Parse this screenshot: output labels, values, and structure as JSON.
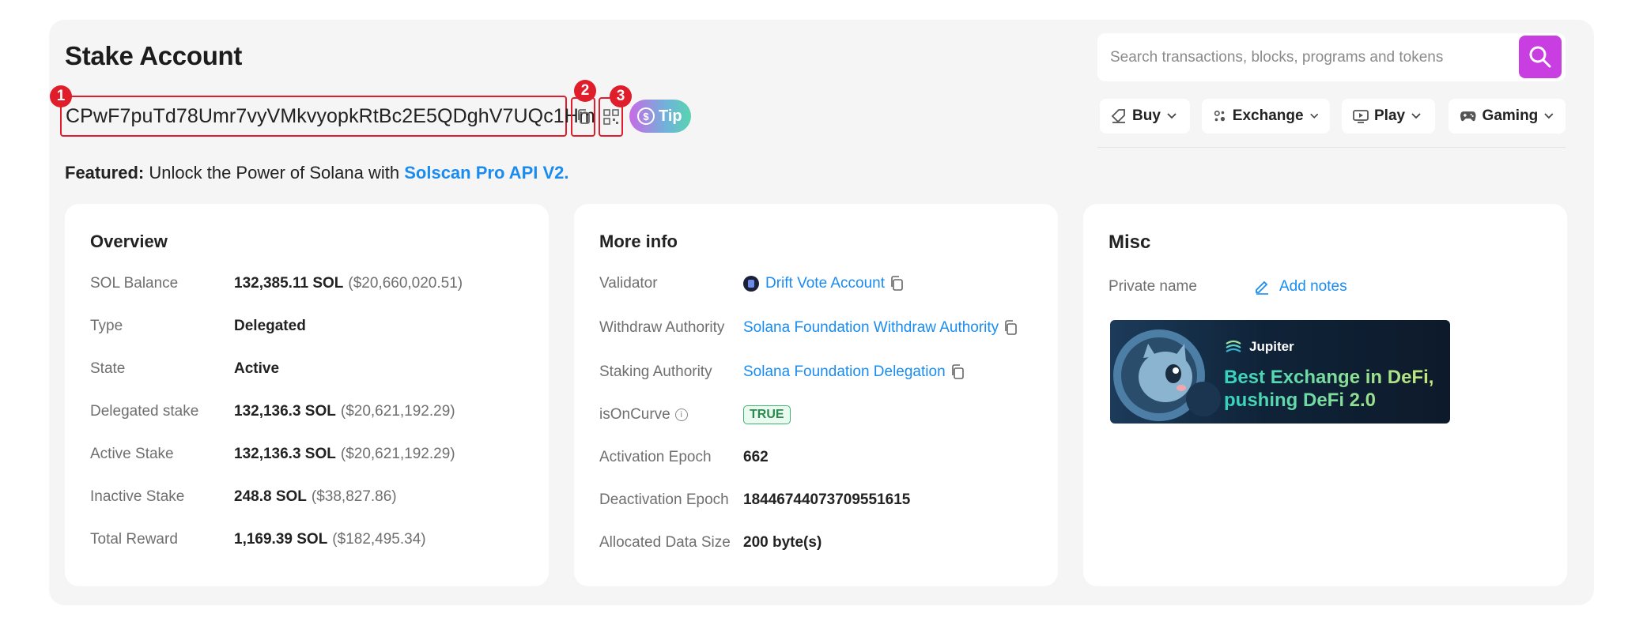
{
  "page": {
    "title": "Stake Account"
  },
  "search": {
    "placeholder": "Search transactions, blocks, programs and tokens"
  },
  "address": {
    "value": "CPwF7puTd78Umr7vyVMkvyopkRtBc2E5QDghV7UQc1Hm",
    "markers": [
      "1",
      "2",
      "3"
    ],
    "tip_label": "Tip"
  },
  "nav": {
    "buy": "Buy",
    "exchange": "Exchange",
    "play": "Play",
    "gaming": "Gaming"
  },
  "featured": {
    "prefix": "Featured:",
    "text": "Unlock the Power of Solana with",
    "link": "Solscan Pro API V2."
  },
  "overview": {
    "title": "Overview",
    "rows": [
      {
        "label": "SOL Balance",
        "value": "132,385.11 SOL",
        "usd": "($20,660,020.51)"
      },
      {
        "label": "Type",
        "value": "Delegated",
        "usd": ""
      },
      {
        "label": "State",
        "value": "Active",
        "usd": ""
      },
      {
        "label": "Delegated stake",
        "value": "132,136.3 SOL",
        "usd": "($20,621,192.29)"
      },
      {
        "label": "Active Stake",
        "value": "132,136.3 SOL",
        "usd": "($20,621,192.29)"
      },
      {
        "label": "Inactive Stake",
        "value": "248.8 SOL",
        "usd": "($38,827.86)"
      },
      {
        "label": "Total Reward",
        "value": "1,169.39 SOL",
        "usd": "($182,495.34)"
      }
    ]
  },
  "more_info": {
    "title": "More info",
    "validator_label": "Validator",
    "validator_value": "Drift Vote Account",
    "withdraw_label": "Withdraw Authority",
    "withdraw_value": "Solana Foundation Withdraw Authority",
    "staking_label": "Staking Authority",
    "staking_value": "Solana Foundation Delegation",
    "oncurve_label": "isOnCurve",
    "oncurve_value": "TRUE",
    "activation_label": "Activation Epoch",
    "activation_value": "662",
    "deactivation_label": "Deactivation Epoch",
    "deactivation_value": "18446744073709551615",
    "datasize_label": "Allocated Data Size",
    "datasize_value": "200 byte(s)"
  },
  "misc": {
    "title": "Misc",
    "private_name_label": "Private name",
    "add_notes": "Add notes",
    "banner_brand": "Jupiter",
    "banner_line1": "Best Exchange in DeFi,",
    "banner_line2": "pushing DeFi 2.0"
  },
  "colors": {
    "accent_purple": "#c93ee0",
    "link_blue": "#1a8cf0",
    "annotation_red": "#e01d2a",
    "true_green": "#2a8a4e"
  }
}
